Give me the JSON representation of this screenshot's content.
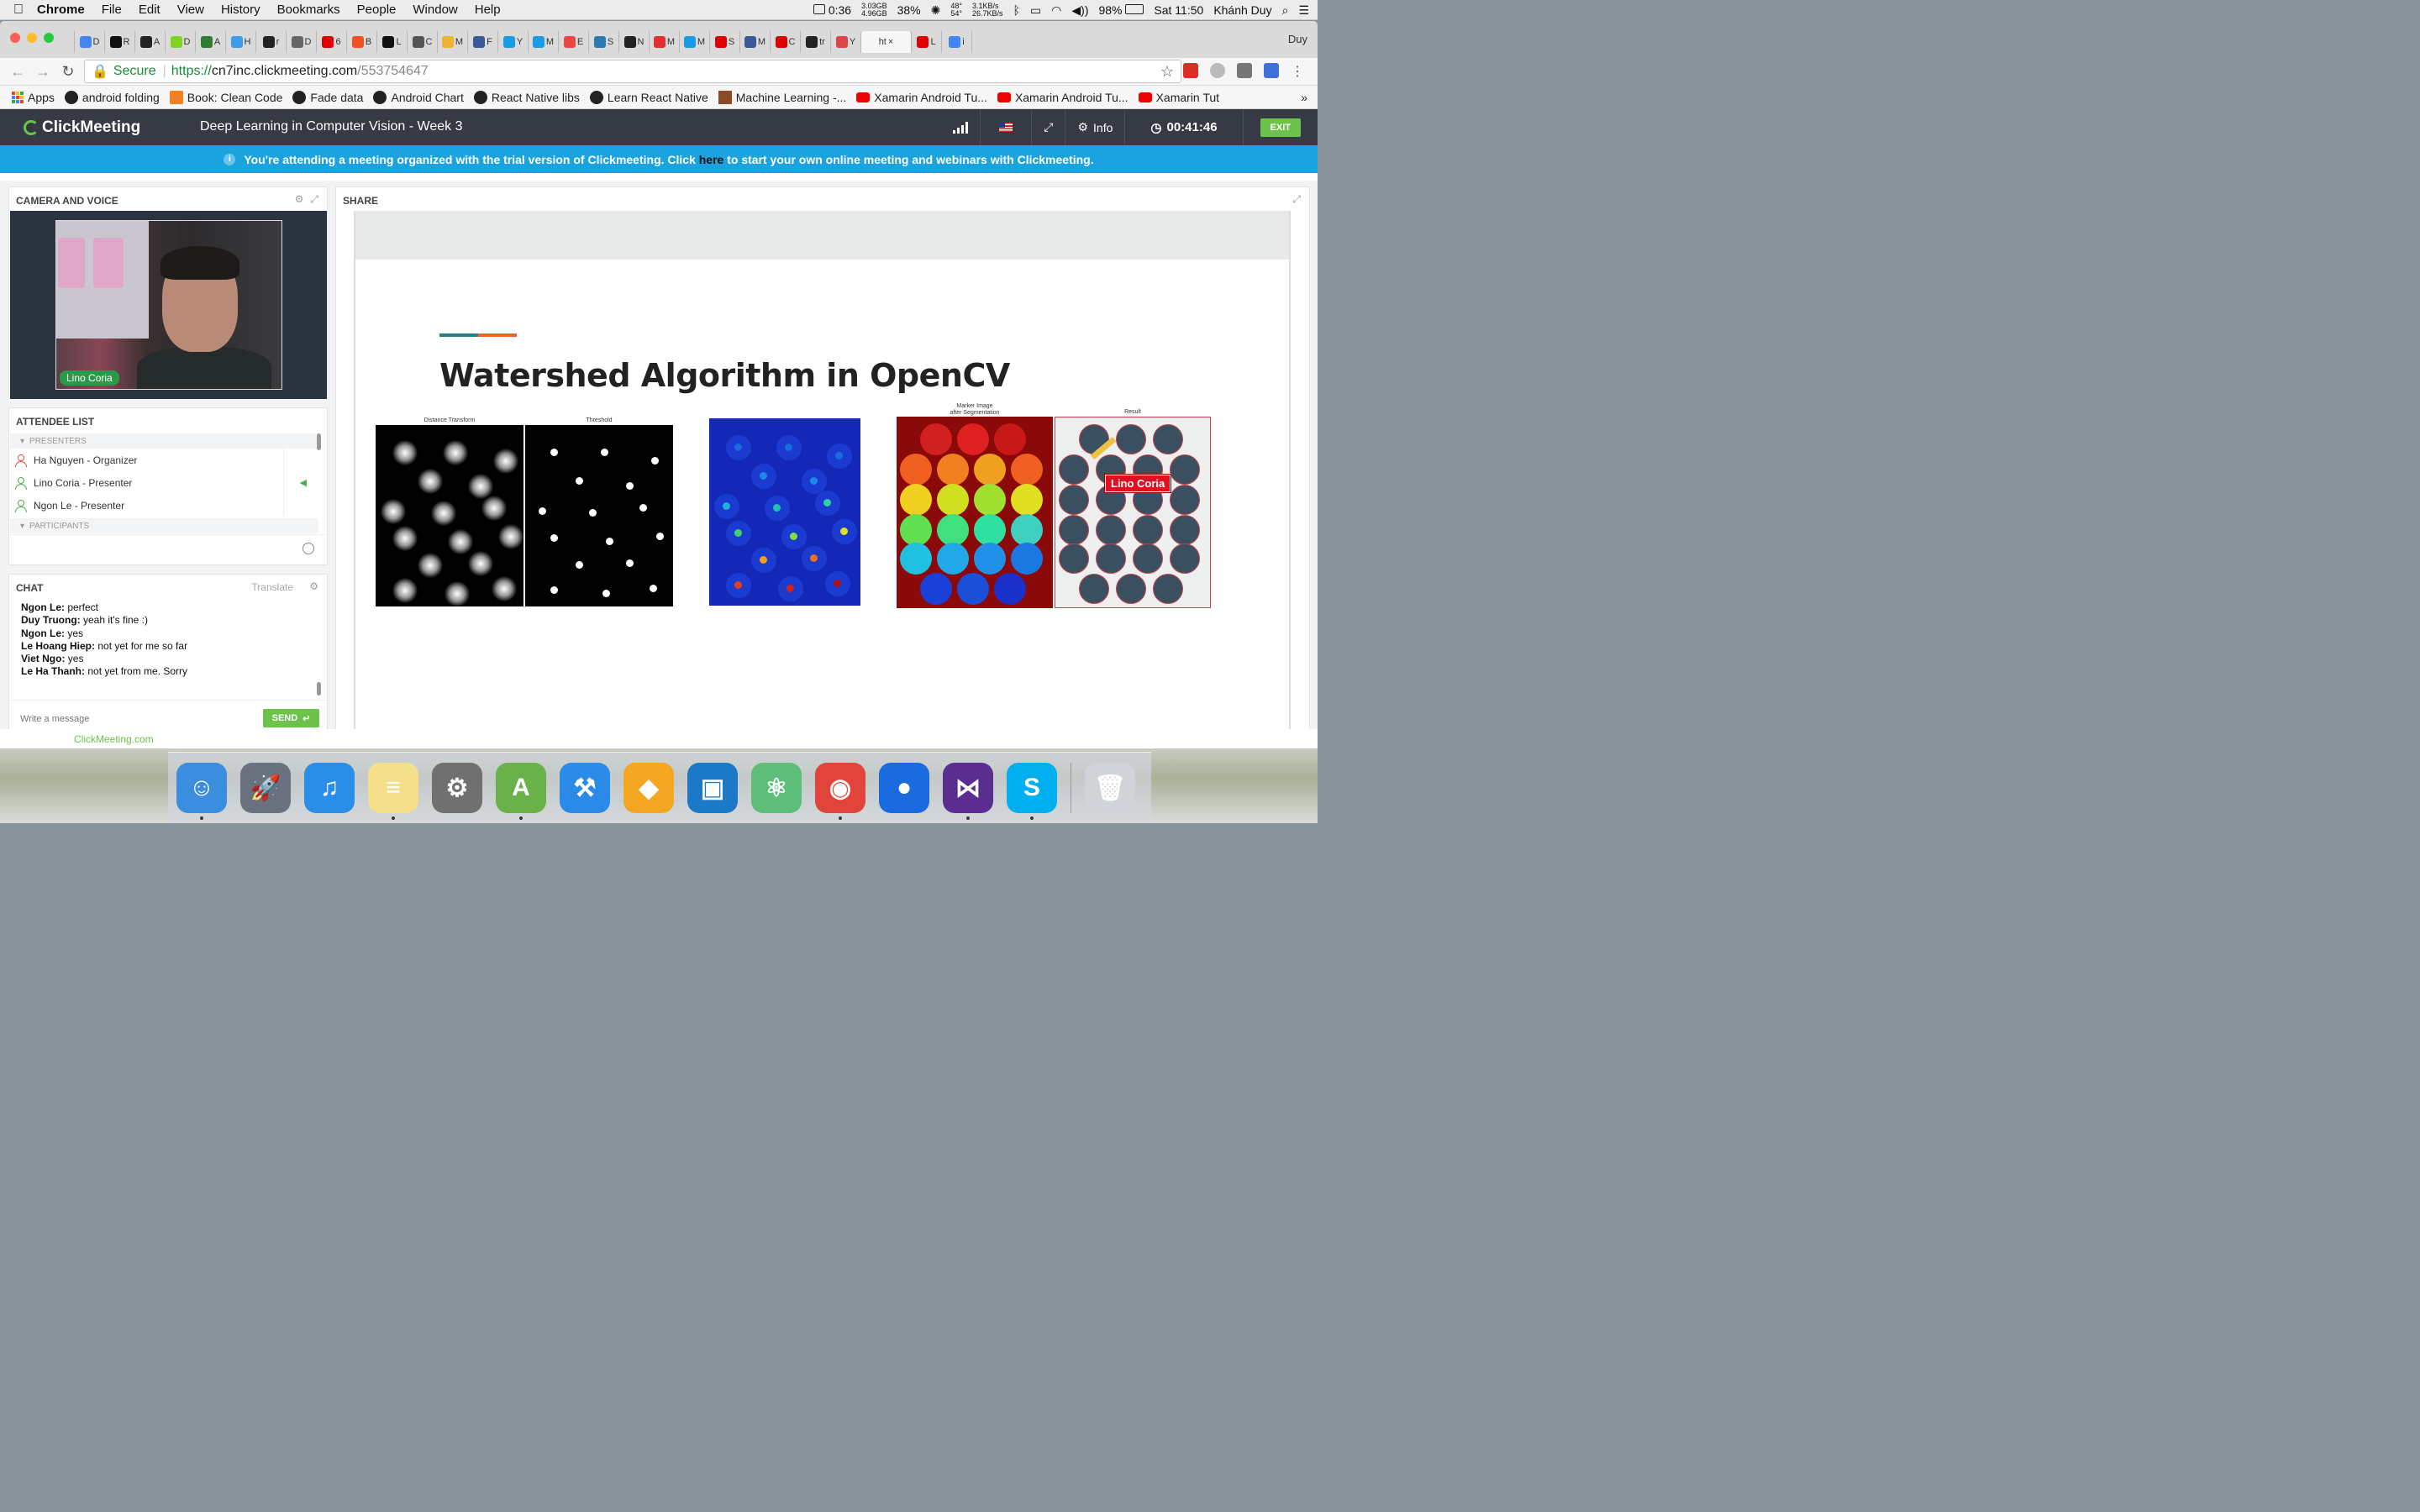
{
  "menubar": {
    "app": "Chrome",
    "menus": [
      "File",
      "Edit",
      "View",
      "History",
      "Bookmarks",
      "People",
      "Window",
      "Help"
    ],
    "battery_time": "0:36",
    "mem_used": "3.03GB",
    "mem_free": "4.96GB",
    "cpu": "38%",
    "temp_hi": "48°",
    "temp_lo": "54°",
    "net_up": "3.1KB/s",
    "net_down": "26.7KB/s",
    "battery": "98%",
    "clock": "Sat 11:50",
    "user": "Khánh Duy"
  },
  "browser": {
    "tab_user": "Duy",
    "active_tab_label": "ht",
    "tabs": [
      {
        "letter": "D",
        "color": "#4285f4"
      },
      {
        "letter": "R",
        "color": "#111111"
      },
      {
        "letter": "A",
        "color": "#222222"
      },
      {
        "letter": "D",
        "color": "#7ed321"
      },
      {
        "letter": "A",
        "color": "#2e7d32"
      },
      {
        "letter": "H",
        "color": "#3d9be9"
      },
      {
        "letter": "r",
        "color": "#222222"
      },
      {
        "letter": "D",
        "color": "#666666"
      },
      {
        "letter": "6",
        "color": "#e00000"
      },
      {
        "letter": "B",
        "color": "#f25022"
      },
      {
        "letter": "L",
        "color": "#111111"
      },
      {
        "letter": "C",
        "color": "#555555"
      },
      {
        "letter": "M",
        "color": "#f0b030"
      },
      {
        "letter": "F",
        "color": "#3b5998"
      },
      {
        "letter": "Y",
        "color": "#1a9be6"
      },
      {
        "letter": "M",
        "color": "#1a9be6"
      },
      {
        "letter": "E",
        "color": "#e44"
      },
      {
        "letter": "S",
        "color": "#2a7ab0"
      },
      {
        "letter": "N",
        "color": "#222222"
      },
      {
        "letter": "M",
        "color": "#e03030"
      },
      {
        "letter": "M",
        "color": "#1a9be6"
      },
      {
        "letter": "S",
        "color": "#e00000"
      },
      {
        "letter": "M",
        "color": "#3b5998"
      },
      {
        "letter": "C",
        "color": "#e00000"
      },
      {
        "letter": "tr",
        "color": "#222222"
      },
      {
        "letter": "Y",
        "color": "#d44"
      }
    ],
    "trailing_tabs": [
      {
        "letter": "L",
        "color": "#e00000"
      },
      {
        "letter": "i",
        "color": "#4285f4"
      }
    ],
    "url_secure_label": "Secure",
    "url_scheme": "https://",
    "url_host": "cn7inc.clickmeeting.com",
    "url_path": "/553754647",
    "bookmarks": [
      {
        "label": "Apps",
        "icon": "apps-icon"
      },
      {
        "label": "android folding",
        "icon": "github-icon"
      },
      {
        "label": "Book: Clean Code",
        "icon": "blogger-icon"
      },
      {
        "label": "Fade data",
        "icon": "github-icon"
      },
      {
        "label": "Android Chart",
        "icon": "github-icon"
      },
      {
        "label": "React Native libs",
        "icon": "github-icon"
      },
      {
        "label": "Learn React Native",
        "icon": "github-icon"
      },
      {
        "label": "Machine Learning -...",
        "icon": "ml-icon"
      },
      {
        "label": "Xamarin Android Tu...",
        "icon": "youtube-icon"
      },
      {
        "label": "Xamarin Android Tu...",
        "icon": "youtube-icon"
      },
      {
        "label": "Xamarin Tut",
        "icon": "youtube-icon"
      }
    ]
  },
  "meeting": {
    "brand": "ClickMeeting",
    "title": "Deep Learning in Computer Vision - Week 3",
    "info_label": "Info",
    "timer": "00:41:46",
    "exit_label": "EXIT",
    "banner_pre": "You're attending a meeting organized with the trial version of Clickmeeting. Click ",
    "banner_link": "here",
    "banner_post": " to start your own online meeting and webinars with Clickmeeting."
  },
  "camera": {
    "title": "CAMERA AND VOICE",
    "presenter_name": "Lino Coria"
  },
  "attendees": {
    "title": "ATTENDEE LIST",
    "presenters_header": "PRESENTERS",
    "participants_header": "PARTICIPANTS",
    "presenters": [
      {
        "name": "Ha Nguyen - Organizer",
        "color": "#e0503a"
      },
      {
        "name": "Lino Coria - Presenter",
        "color": "#4caf50"
      },
      {
        "name": "Ngon Le - Presenter",
        "color": "#4caf50"
      }
    ]
  },
  "chat": {
    "title": "CHAT",
    "translate_label": "Translate",
    "messages": [
      {
        "author": "Ngon Le:",
        "text": " perfect"
      },
      {
        "author": "Duy Truong:",
        "text": " yeah it's fine :)"
      },
      {
        "author": "Ngon Le:",
        "text": " yes"
      },
      {
        "author": "Le Hoang Hiep:",
        "text": " not yet for me so far"
      },
      {
        "author": "Viet Ngo:",
        "text": " yes"
      },
      {
        "author": "Le Ha Thanh:",
        "text": " not yet from me. Sorry"
      }
    ],
    "input_placeholder": "Write a message",
    "send_label": "SEND"
  },
  "share": {
    "title": "SHARE",
    "slide_title": "Watershed Algorithm in OpenCV",
    "captions": {
      "distance": "Distance Transform",
      "threshold": "Threshold",
      "marker_line1": "Marker Image",
      "marker_line2": "after Segmentation",
      "result": "Result"
    },
    "annotation_name": "Lino Coria",
    "accent_colors": [
      "#2a7f86",
      "#e8642a"
    ]
  },
  "footer": {
    "powered_by": "ClickMeeting.com"
  },
  "dock": {
    "apps": [
      {
        "name": "finder-icon",
        "color": "#3b8de0",
        "glyph": "☺",
        "running": true
      },
      {
        "name": "launchpad-icon",
        "color": "#6a7280",
        "glyph": "🚀",
        "running": false
      },
      {
        "name": "itunes-icon",
        "color": "#2a8de8",
        "glyph": "♫",
        "running": false
      },
      {
        "name": "notes-icon",
        "color": "#f4e08a",
        "glyph": "≡",
        "running": true
      },
      {
        "name": "system-preferences-icon",
        "color": "#707070",
        "glyph": "⚙",
        "running": false
      },
      {
        "name": "android-studio-icon",
        "color": "#6bb14a",
        "glyph": "A",
        "running": true
      },
      {
        "name": "xcode-icon",
        "color": "#2a8ae8",
        "glyph": "⚒",
        "running": false
      },
      {
        "name": "sketch-icon",
        "color": "#f5a623",
        "glyph": "◆",
        "running": false
      },
      {
        "name": "vmware-icon",
        "color": "#1b79c8",
        "glyph": "▣",
        "running": false
      },
      {
        "name": "atom-icon",
        "color": "#5fbf7a",
        "glyph": "⚛",
        "running": false
      },
      {
        "name": "chrome-icon",
        "color": "#e0443a",
        "glyph": "◉",
        "running": true
      },
      {
        "name": "maps-pin-icon",
        "color": "#1a6ae0",
        "glyph": "●",
        "running": false
      },
      {
        "name": "visual-studio-icon",
        "color": "#5c2d91",
        "glyph": "⋈",
        "running": true
      },
      {
        "name": "skype-icon",
        "color": "#00aff0",
        "glyph": "S",
        "running": true
      },
      {
        "name": "trash-icon",
        "color": "#d0d4d8",
        "glyph": "🗑",
        "running": false
      }
    ]
  }
}
